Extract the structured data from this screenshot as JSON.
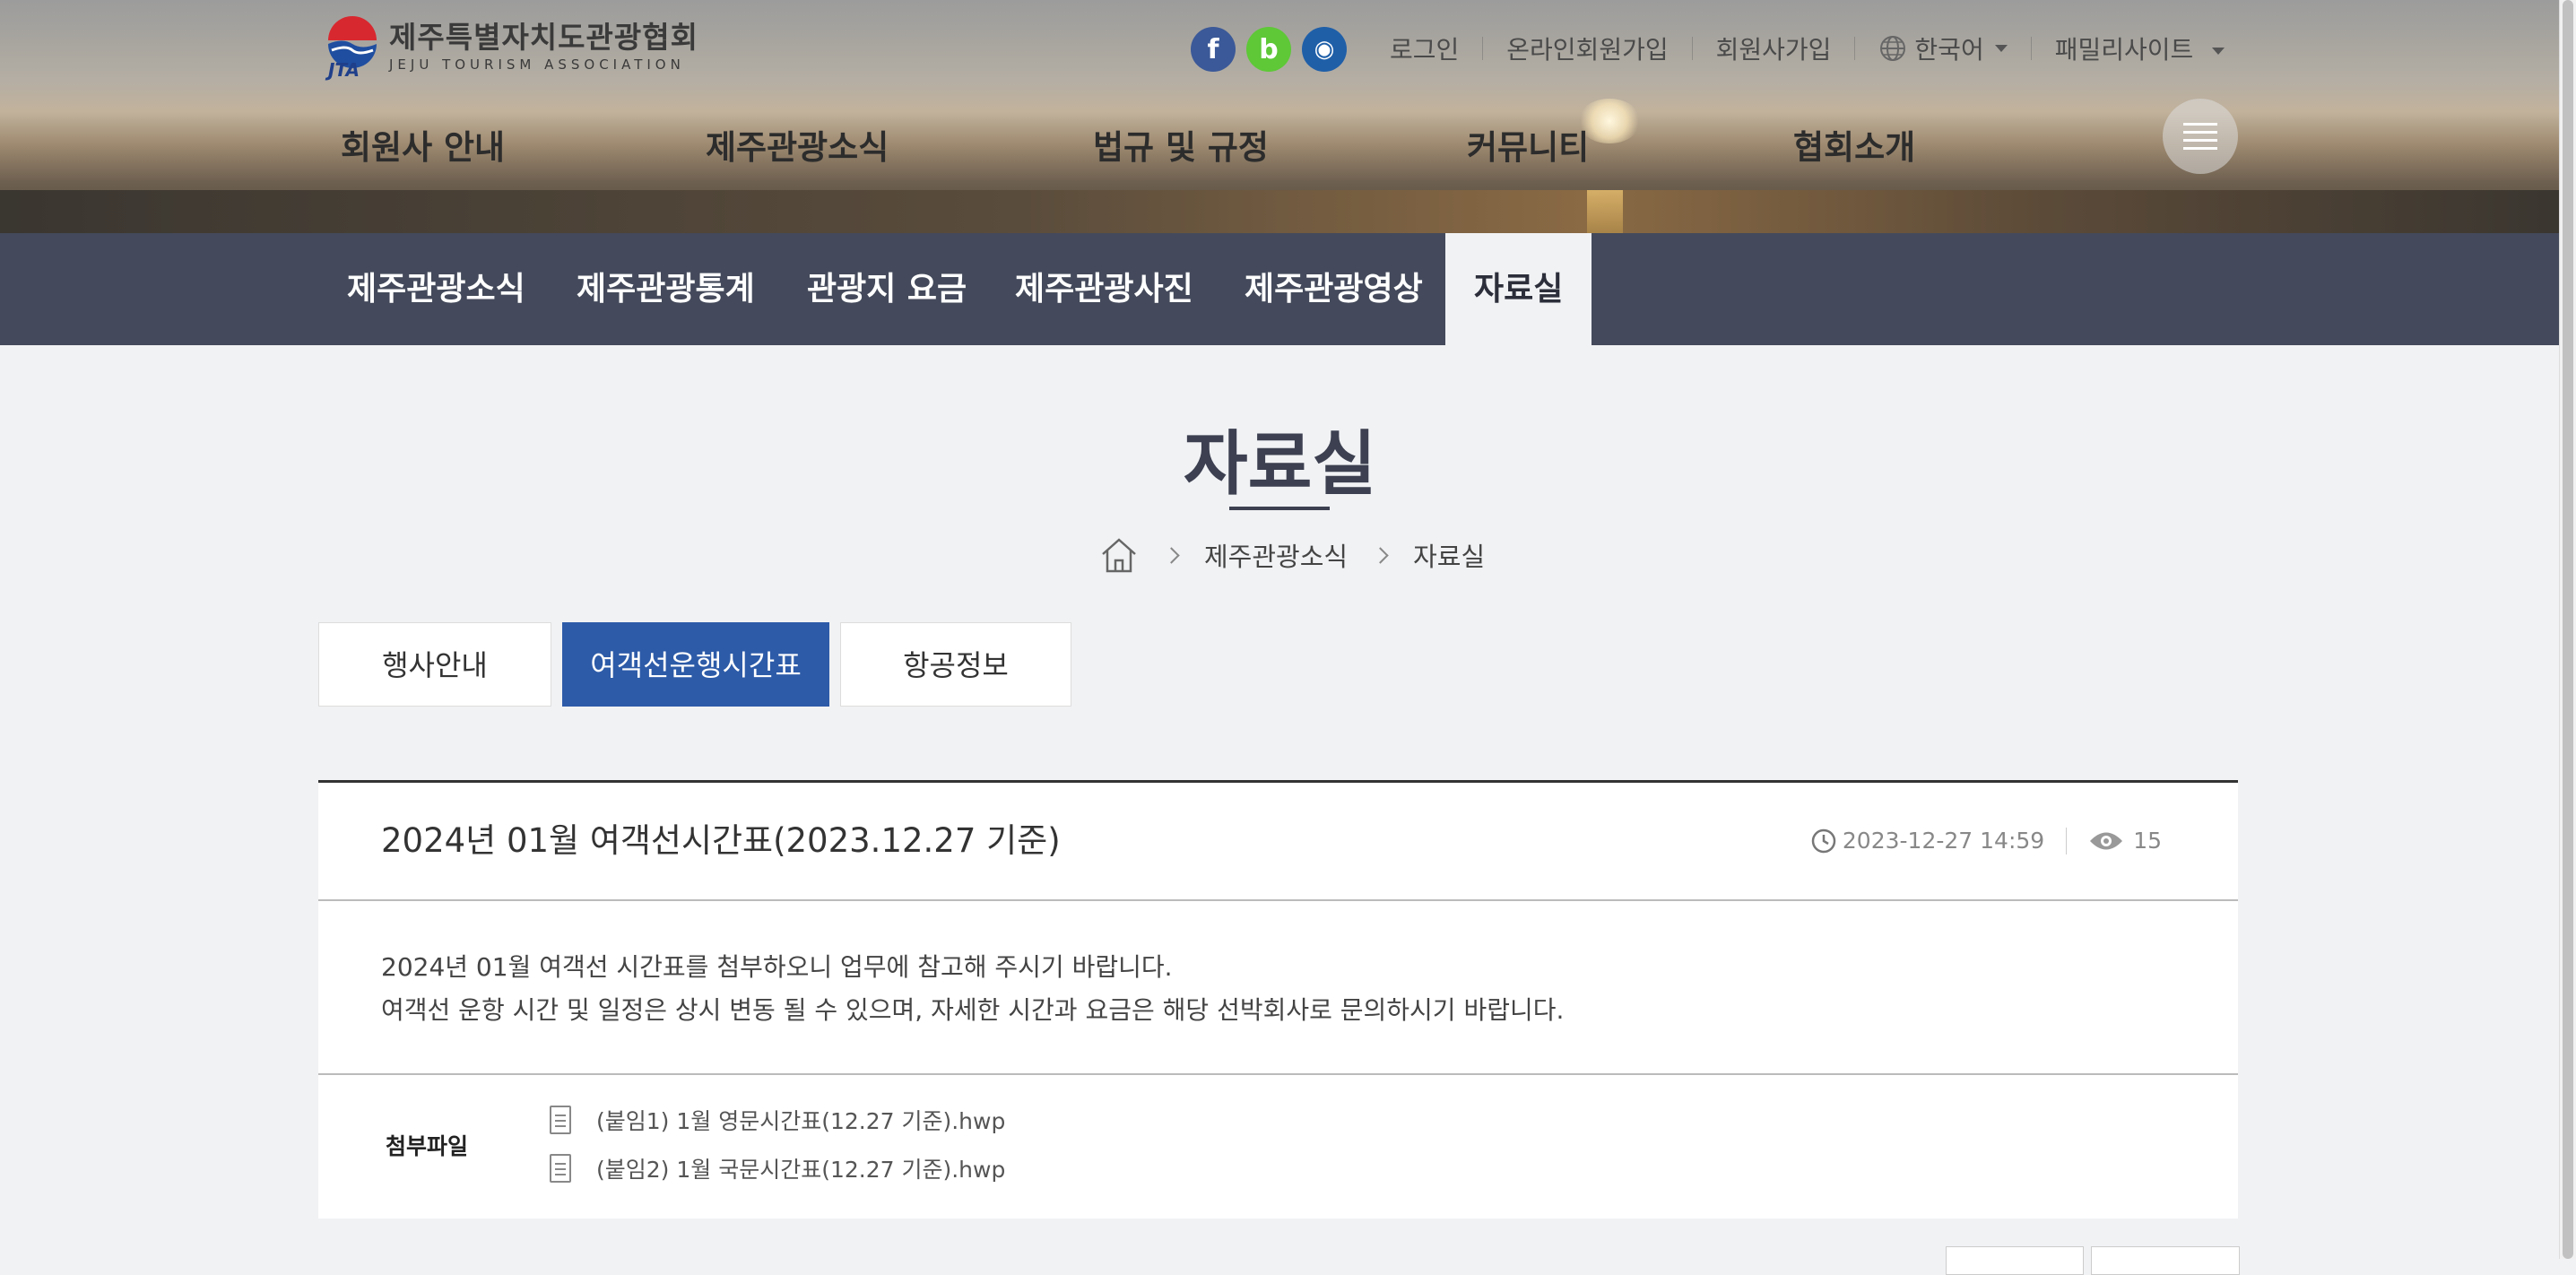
{
  "header": {
    "logo_kr": "제주특별자치도관광협회",
    "logo_en": "JEJU TOURISM ASSOCIATION",
    "logo_mark": "JTA",
    "social": [
      {
        "icon": "facebook-icon",
        "glyph": "f",
        "color": "#3b5998"
      },
      {
        "icon": "blog-icon",
        "glyph": "b",
        "color": "#5ec837"
      },
      {
        "icon": "instagram-icon",
        "glyph": "◉",
        "color": "#1f5fa8"
      }
    ],
    "links": {
      "login": "로그인",
      "online_join": "온라인회원가입",
      "member_join": "회원사가입",
      "language": "한국어",
      "family_site": "패밀리사이트"
    },
    "main_menu": [
      "회원사 안내",
      "제주관광소식",
      "법규 및 규정",
      "커뮤니티",
      "협회소개"
    ]
  },
  "subnav": [
    "제주관광소식",
    "제주관광통계",
    "관광지 요금",
    "제주관광사진",
    "제주관광영상",
    "자료실"
  ],
  "subnav_active": "자료실",
  "page": {
    "title": "자료실",
    "breadcrumb": [
      "제주관광소식",
      "자료실"
    ]
  },
  "tabs": [
    "행사안내",
    "여객선운행시간표",
    "항공정보"
  ],
  "active_tab": "여객선운행시간표",
  "article": {
    "title": "2024년 01월 여객선시간표(2023.12.27 기준)",
    "date": "2023-12-27 14:59",
    "views": "15",
    "body_line1": "2024년 01월 여객선 시간표를 첨부하오니 업무에 참고해 주시기 바랍니다.",
    "body_line2": "여객선 운항 시간 및 일정은 상시 변동 될 수 있으며, 자세한 시간과 요금은 해당 선박회사로 문의하시기 바랍니다.",
    "files_label": "첨부파일",
    "files": [
      "(붙임1) 1월 영문시간표(12.27 기준).hwp",
      "(붙임2) 1월 국문시간표(12.27 기준).hwp"
    ]
  },
  "colors": {
    "subnav_bg": "#444a5b",
    "active_tab": "#2d5ba8",
    "page_bg": "#f1f2f4"
  }
}
